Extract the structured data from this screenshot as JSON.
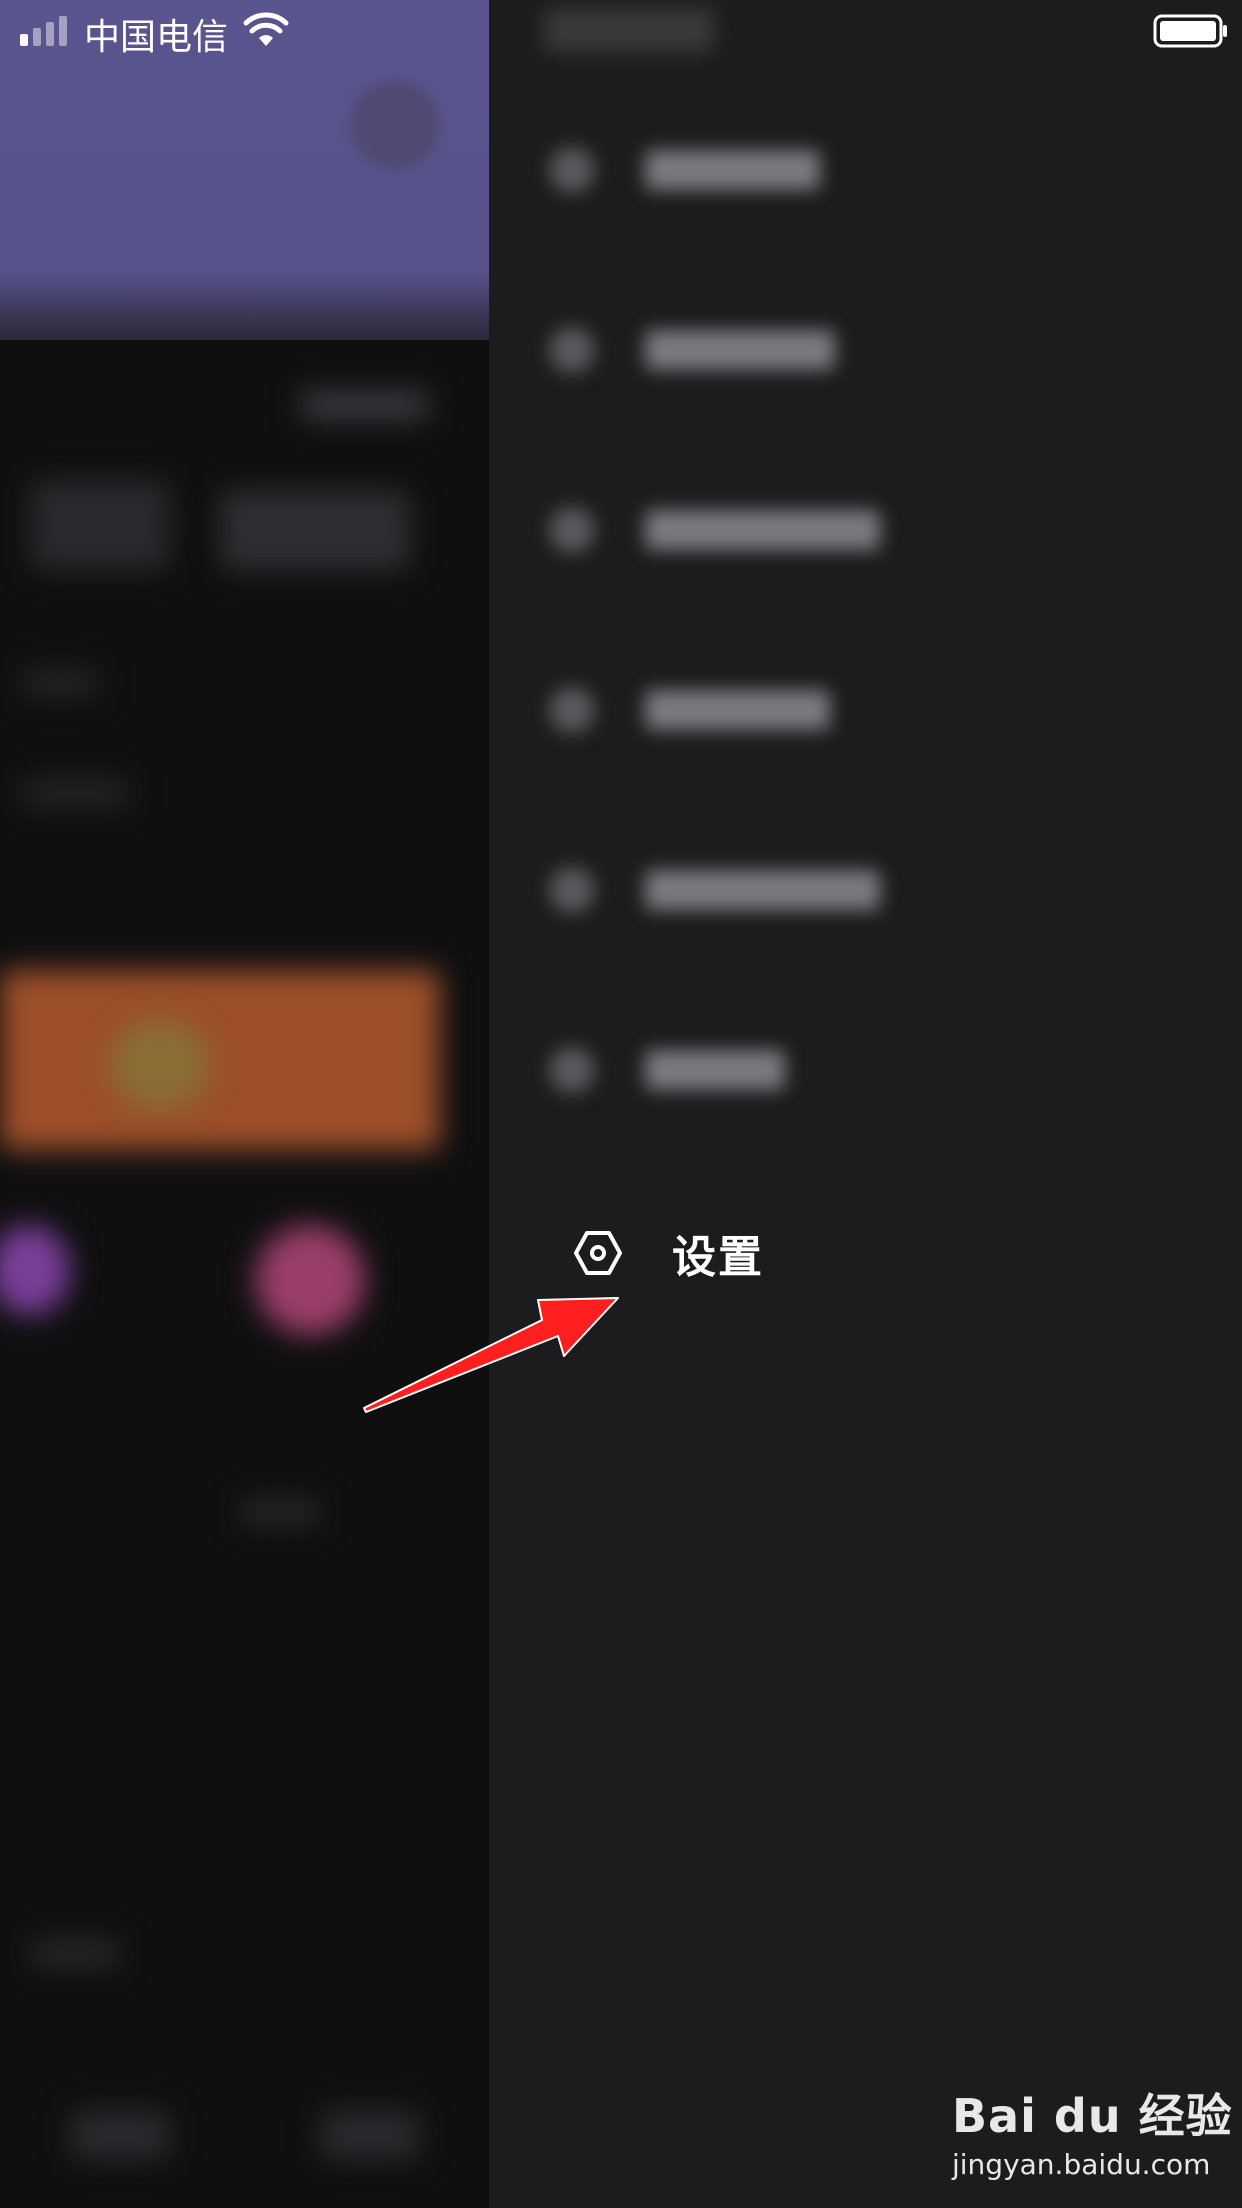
{
  "status_bar": {
    "carrier": "中国电信",
    "signal_bars_active": 1,
    "signal_bars_total": 4
  },
  "drawer": {
    "settings_label": "设置",
    "settings_icon": "settings-hexagon-icon"
  },
  "watermark": {
    "brand": "Bai du 经验",
    "url": "jingyan.baidu.com"
  },
  "colors": {
    "drawer_bg": "#1c1c1e",
    "left_header": "#5a558f",
    "arrow": "#ff1f1f"
  }
}
